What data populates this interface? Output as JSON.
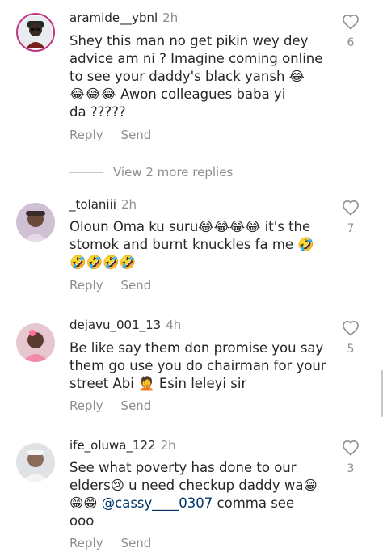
{
  "colors": {
    "username": "#262626",
    "meta": "#8e8e8e",
    "mention": "#00376b",
    "story_ring": "#c13584"
  },
  "comments": [
    {
      "username": "aramide__ybnl",
      "time": "2h",
      "text_lines": [
        "Shey this man no get pikin wey dey",
        "advice am ni ? Imagine coming online",
        "to see your daddy's black yansh 😂",
        "😂😂😂 Awon colleagues baba yi",
        "da ?????"
      ],
      "reply": "Reply",
      "send": "Send",
      "likes": "6",
      "like_icon": "heart-outline-icon"
    },
    {
      "username": "_tolaniii",
      "time": "2h",
      "text_lines": [
        "Oloun Oma ku suru😂😂😂😂 it's the",
        "stomok and burnt knuckles fa me 🤣",
        "🤣🤣🤣🤣"
      ],
      "reply": "Reply",
      "send": "Send",
      "likes": "7",
      "like_icon": "heart-outline-icon"
    },
    {
      "username": "dejavu_001_13",
      "time": "4h",
      "text_lines": [
        "Be like say them don promise you say",
        "them go use you do chairman for your",
        "street Abi 🤦 Esin leleyi sir"
      ],
      "reply": "Reply",
      "send": "Send",
      "likes": "5",
      "like_icon": "heart-outline-icon"
    },
    {
      "username": "ife_oluwa_122",
      "time": "2h",
      "text_lines": [
        "See what poverty has done to our",
        "elders😢 u need checkup daddy wa😁",
        "😁😁 ",
        "ooo"
      ],
      "mention": "@cassy____0307",
      "after_mention": " comma see",
      "reply": "Reply",
      "send": "Send",
      "likes": "3",
      "like_icon": "heart-outline-icon"
    }
  ],
  "view_more": "View 2 more replies"
}
